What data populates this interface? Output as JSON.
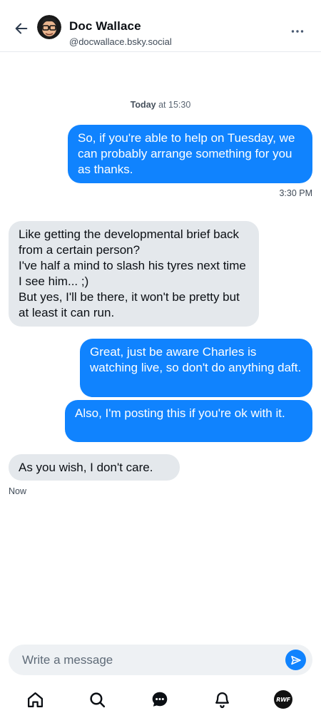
{
  "header": {
    "name": "Doc Wallace",
    "handle": "@docwallace.bsky.social",
    "back_icon": "arrow-left-icon",
    "more_icon": "more-horizontal-icon"
  },
  "conversation": {
    "day_label": "Today",
    "day_time": "at 15:30",
    "messages": [
      {
        "from": "me",
        "text": "So, if you're able to help on Tuesday, we can probably arrange something for you as thanks."
      },
      {
        "from": "them",
        "text": "Like getting the developmental brief back from a certain person?\nI've half a mind to slash his tyres next time I see him... ;)\nBut yes, I'll be there, it won't be pretty but at least it can run."
      },
      {
        "from": "me",
        "text": "Great, just be aware Charles is watching live, so don't do anything daft."
      },
      {
        "from": "me",
        "text": "Also, I'm posting this if you're ok with it."
      },
      {
        "from": "them",
        "text": "As you wish, I don't care."
      }
    ],
    "timestamps": {
      "first_out": "3:30 PM",
      "last_in": "Now"
    }
  },
  "composer": {
    "placeholder": "Write a message",
    "send_icon": "send-icon"
  },
  "tabbar": {
    "items": [
      "home-icon",
      "search-icon",
      "chat-icon",
      "bell-icon",
      "profile-avatar"
    ],
    "avatar_text": "RWF"
  },
  "colors": {
    "accent": "#1083fe",
    "incoming_bubble": "#e4e8ec"
  }
}
